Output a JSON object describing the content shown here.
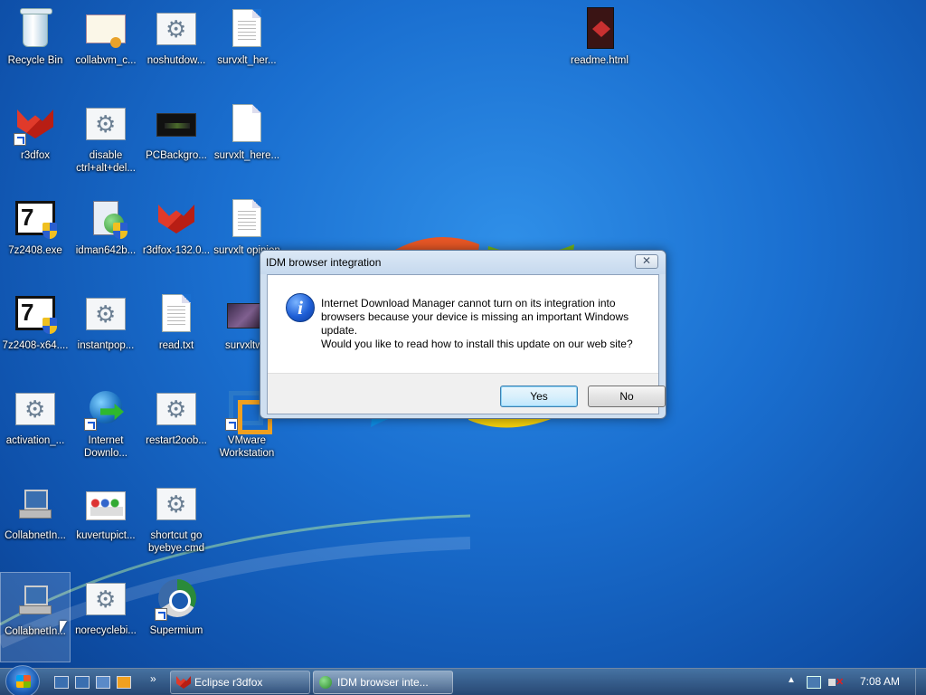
{
  "desktop": {
    "icons": [
      {
        "label": "Recycle Bin"
      },
      {
        "label": "collabvm_c..."
      },
      {
        "label": "noshutdow..."
      },
      {
        "label": "survxlt_her..."
      },
      {
        "label": "readme.html"
      },
      {
        "label": "r3dfox"
      },
      {
        "label": "disable ctrl+alt+del..."
      },
      {
        "label": "PCBackgro..."
      },
      {
        "label": "survxlt_here..."
      },
      {
        "label": "7z2408.exe"
      },
      {
        "label": "idman642b..."
      },
      {
        "label": "r3dfox-132.0..."
      },
      {
        "label": "survxlt opinion"
      },
      {
        "label": "7z2408-x64...."
      },
      {
        "label": "instantpop..."
      },
      {
        "label": "read.txt"
      },
      {
        "label": "survxltwa"
      },
      {
        "label": "activation_..."
      },
      {
        "label": "Internet Downlo..."
      },
      {
        "label": "restart2oob..."
      },
      {
        "label": "VMware Workstation"
      },
      {
        "label": "CollabnetIn..."
      },
      {
        "label": "kuvertupict..."
      },
      {
        "label": "shortcut go byebye.cmd"
      },
      {
        "label": "CollabnetIn..."
      },
      {
        "label": "norecyclebi..."
      },
      {
        "label": "Supermium"
      }
    ]
  },
  "dialog": {
    "title": "IDM browser integration",
    "close_glyph": "✕",
    "message_line1": "Internet Download Manager cannot turn on its integration into browsers because your device is missing an important Windows update.",
    "message_line2": "Would you like to read how to install this update on our web site?",
    "yes_label": "Yes",
    "no_label": "No"
  },
  "taskbar": {
    "tasks": [
      {
        "label": "Eclipse r3dfox"
      },
      {
        "label": "IDM browser inte..."
      }
    ],
    "clock": "7:08 AM",
    "tray_arrow": "▲",
    "quicklaunch_chevron": "»"
  },
  "colors": {
    "desktop_bg": "#1a6fd0",
    "dialog_frame": "#cfdff0",
    "default_button": "#bee6fd",
    "taskbar": "#3a5f8a"
  }
}
